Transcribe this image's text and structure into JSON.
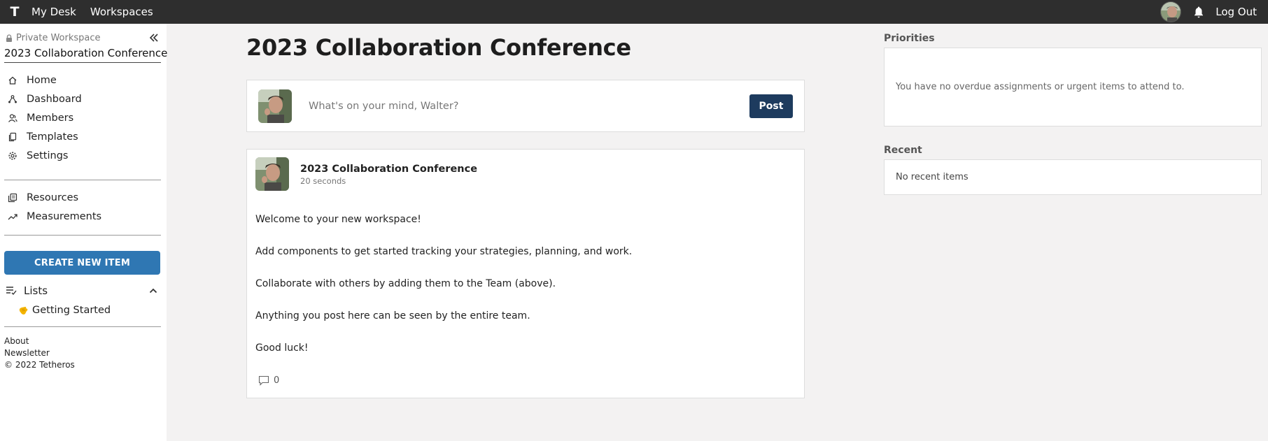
{
  "topbar": {
    "logo": "T",
    "nav": [
      "My Desk",
      "Workspaces"
    ],
    "logout": "Log Out"
  },
  "sidebar": {
    "privacy": "Private Workspace",
    "workspace_name": "2023 Collaboration Conference",
    "nav_primary": [
      "Home",
      "Dashboard",
      "Members",
      "Templates",
      "Settings"
    ],
    "nav_secondary": [
      "Resources",
      "Measurements"
    ],
    "create_button": "CREATE NEW ITEM",
    "lists_heading": "Lists",
    "lists": [
      "Getting Started"
    ],
    "footer": [
      "About",
      "Newsletter",
      "© 2022 Tetheros"
    ]
  },
  "main": {
    "title": "2023 Collaboration Conference",
    "composer_placeholder": "What's on your mind, Walter?",
    "post_button": "Post",
    "post": {
      "title": "2023 Collaboration Conference",
      "time": "20 seconds",
      "paragraphs": [
        "Welcome to your new workspace!",
        "Add components to get started tracking your strategies, planning, and work.",
        "Collaborate with others by adding them to the Team (above).",
        "Anything you post here can be seen by the entire team.",
        "Good luck!"
      ],
      "comment_count": "0"
    }
  },
  "right": {
    "priorities_label": "Priorities",
    "priorities_text": "You have no overdue assignments or urgent items to attend to.",
    "recent_label": "Recent",
    "recent_text": "No recent items"
  },
  "colors": {
    "topbar": "#2e2e2e",
    "create_button": "#2f77b3",
    "post_button": "#1d3b5e"
  }
}
